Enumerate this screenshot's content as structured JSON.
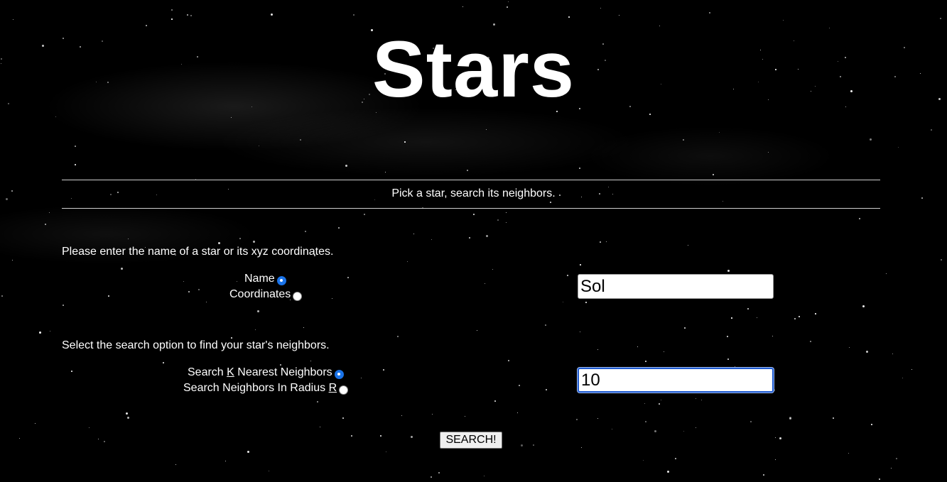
{
  "header": {
    "title": "Stars",
    "tagline": "Pick a star, search its neighbors."
  },
  "star_section": {
    "prompt": "Please enter the name of a star or its xyz coordinates.",
    "options": [
      {
        "label": "Name",
        "checked": true
      },
      {
        "label": "Coordinates",
        "checked": false
      }
    ],
    "input_value": "Sol"
  },
  "search_section": {
    "prompt": "Select the search option to find your star's neighbors.",
    "option_knn": {
      "prefix": "Search ",
      "key": "K",
      "suffix": " Nearest Neighbors",
      "checked": true
    },
    "option_radius": {
      "prefix": "Search Neighbors In Radius ",
      "key": "R",
      "checked": false
    },
    "input_value": "10"
  },
  "actions": {
    "search_label": "SEARCH!"
  },
  "colors": {
    "background": "#000000",
    "text": "#ffffff",
    "radio_checked": "#1a73e8",
    "focus_border": "#1f5bd0"
  }
}
